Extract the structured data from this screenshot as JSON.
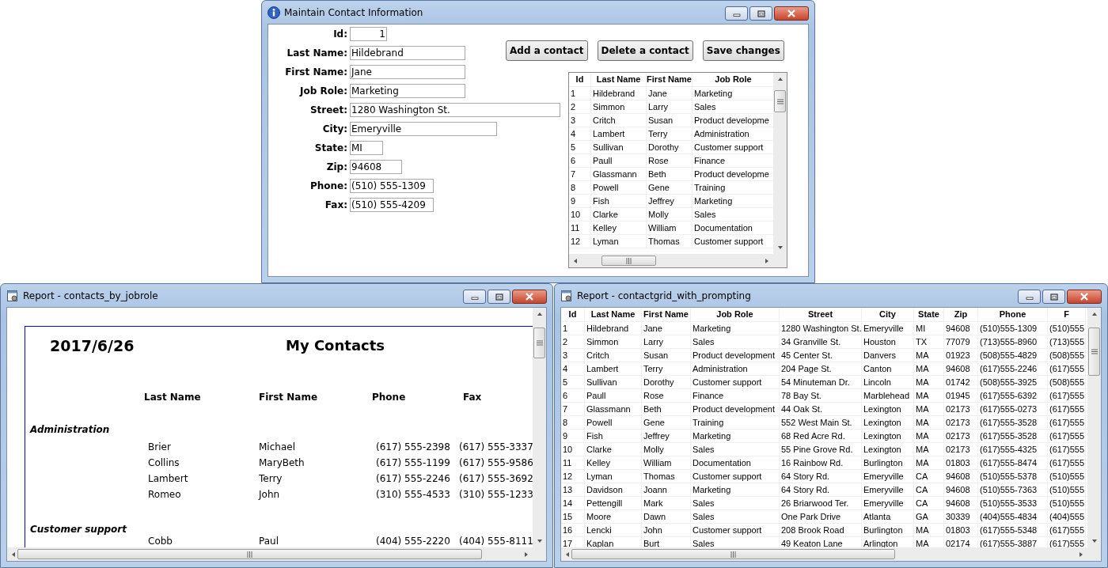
{
  "contact_form_window": {
    "title": "Maintain Contact Information",
    "fields": [
      {
        "label": "Id:",
        "value": "1",
        "kind": "numeric"
      },
      {
        "label": "Last Name:",
        "value": "Hildebrand",
        "kind": "text"
      },
      {
        "label": "First Name:",
        "value": "Jane",
        "kind": "text"
      },
      {
        "label": "Job Role:",
        "value": "Marketing",
        "kind": "text"
      },
      {
        "label": "Street:",
        "value": "1280 Washington St.",
        "kind": "text"
      },
      {
        "label": "City:",
        "value": "Emeryville",
        "kind": "text"
      },
      {
        "label": "State:",
        "value": "MI",
        "kind": "text"
      },
      {
        "label": "Zip:",
        "value": "94608",
        "kind": "text"
      },
      {
        "label": "Phone:",
        "value": "(510) 555-1309",
        "kind": "text"
      },
      {
        "label": "Fax:",
        "value": "(510) 555-4209",
        "kind": "text"
      }
    ],
    "buttons": [
      "Add a contact",
      "Delete a contact",
      "Save changes"
    ],
    "grid": {
      "columns": [
        "Id",
        "Last Name",
        "First Name",
        "Job Role"
      ],
      "rows": [
        [
          "1",
          "Hildebrand",
          "Jane",
          "Marketing"
        ],
        [
          "2",
          "Simmon",
          "Larry",
          "Sales"
        ],
        [
          "3",
          "Critch",
          "Susan",
          "Product developme"
        ],
        [
          "4",
          "Lambert",
          "Terry",
          "Administration"
        ],
        [
          "5",
          "Sullivan",
          "Dorothy",
          "Customer support"
        ],
        [
          "6",
          "Paull",
          "Rose",
          "Finance"
        ],
        [
          "7",
          "Glassmann",
          "Beth",
          "Product developme"
        ],
        [
          "8",
          "Powell",
          "Gene",
          "Training"
        ],
        [
          "9",
          "Fish",
          "Jeffrey",
          "Marketing"
        ],
        [
          "10",
          "Clarke",
          "Molly",
          "Sales"
        ],
        [
          "11",
          "Kelley",
          "William",
          "Documentation"
        ],
        [
          "12",
          "Lyman",
          "Thomas",
          "Customer support"
        ]
      ]
    }
  },
  "jobrole_report_window": {
    "title": "Report - contacts_by_jobrole",
    "date": "2017/6/26",
    "report_title": "My Contacts",
    "columns": [
      "Last Name",
      "First Name",
      "Phone",
      "Fax"
    ],
    "groups": [
      {
        "name": "Administration",
        "rows": [
          [
            "Brier",
            "Michael",
            "(617) 555-2398",
            "(617) 555-3337"
          ],
          [
            "Collins",
            "MaryBeth",
            "(617) 555-1199",
            "(617) 555-9586"
          ],
          [
            "Lambert",
            "Terry",
            "(617) 555-2246",
            "(617) 555-3692"
          ],
          [
            "Romeo",
            "John",
            "(310) 555-4533",
            "(310) 555-1233"
          ]
        ]
      },
      {
        "name": "Customer support",
        "rows": [
          [
            "Cobb",
            "Paul",
            "(404) 555-2220",
            "(404) 555-8111"
          ]
        ]
      }
    ]
  },
  "contactgrid_window": {
    "title": "Report - contactgrid_with_prompting",
    "grid": {
      "columns": [
        "Id",
        "Last Name",
        "First Name",
        "Job Role",
        "Street",
        "City",
        "State",
        "Zip",
        "Phone",
        "F"
      ],
      "rows": [
        [
          "1",
          "Hildebrand",
          "Jane",
          "Marketing",
          "1280 Washington St.",
          "Emeryville",
          "MI",
          "94608",
          "(510)555-1309",
          "(510)555"
        ],
        [
          "2",
          "Simmon",
          "Larry",
          "Sales",
          "34 Granville St.",
          "Houston",
          "TX",
          "77079",
          "(713)555-8960",
          "(713)555"
        ],
        [
          "3",
          "Critch",
          "Susan",
          "Product development",
          "45 Center St.",
          "Danvers",
          "MA",
          "01923",
          "(508)555-4829",
          "(508)555"
        ],
        [
          "4",
          "Lambert",
          "Terry",
          "Administration",
          "204 Page St.",
          "Canton",
          "MA",
          "94608",
          "(617)555-2246",
          "(617)555"
        ],
        [
          "5",
          "Sullivan",
          "Dorothy",
          "Customer support",
          "54 Minuteman Dr.",
          "Lincoln",
          "MA",
          "01742",
          "(508)555-3925",
          "(508)555"
        ],
        [
          "6",
          "Paull",
          "Rose",
          "Finance",
          "78 Bay St.",
          "Marblehead",
          "MA",
          "01945",
          "(617)555-6392",
          "(617)555"
        ],
        [
          "7",
          "Glassmann",
          "Beth",
          "Product development",
          "44 Oak St.",
          "Lexington",
          "MA",
          "02173",
          "(617)555-0273",
          "(617)555"
        ],
        [
          "8",
          "Powell",
          "Gene",
          "Training",
          "552 West Main St.",
          "Lexington",
          "MA",
          "02173",
          "(617)555-3528",
          "(617)555"
        ],
        [
          "9",
          "Fish",
          "Jeffrey",
          "Marketing",
          "68 Red Acre Rd.",
          "Lexington",
          "MA",
          "02173",
          "(617)555-3528",
          "(617)555"
        ],
        [
          "10",
          "Clarke",
          "Molly",
          "Sales",
          "55 Pine Grove Rd.",
          "Lexington",
          "MA",
          "02173",
          "(617)555-4325",
          "(617)555"
        ],
        [
          "11",
          "Kelley",
          "William",
          "Documentation",
          "16 Rainbow Rd.",
          "Burlington",
          "MA",
          "01803",
          "(617)555-8474",
          "(617)555"
        ],
        [
          "12",
          "Lyman",
          "Thomas",
          "Customer support",
          "64 Story Rd.",
          "Emeryville",
          "CA",
          "94608",
          "(510)555-5378",
          "(510)555"
        ],
        [
          "13",
          "Davidson",
          "Joann",
          "Marketing",
          "64 Story Rd.",
          "Emeryville",
          "CA",
          "94608",
          "(510)555-7363",
          "(510)555"
        ],
        [
          "14",
          "Pettengill",
          "Mark",
          "Sales",
          "26 Briarwood Ter.",
          "Emeryville",
          "CA",
          "94608",
          "(510)555-3533",
          "(510)555"
        ],
        [
          "15",
          "Moore",
          "Dawn",
          "Sales",
          "One Park Drive",
          "Atlanta",
          "GA",
          "30339",
          "(404)555-4834",
          "(404)555"
        ],
        [
          "16",
          "Lencki",
          "John",
          "Customer support",
          "208 Brook Road",
          "Burlington",
          "MA",
          "01803",
          "(617)555-5348",
          "(617)555"
        ],
        [
          "17",
          "Kaplan",
          "Burt",
          "Sales",
          "49 Keaton Lane",
          "Arlington",
          "MA",
          "02174",
          "(617)555-3887",
          "(617)555"
        ]
      ]
    }
  }
}
